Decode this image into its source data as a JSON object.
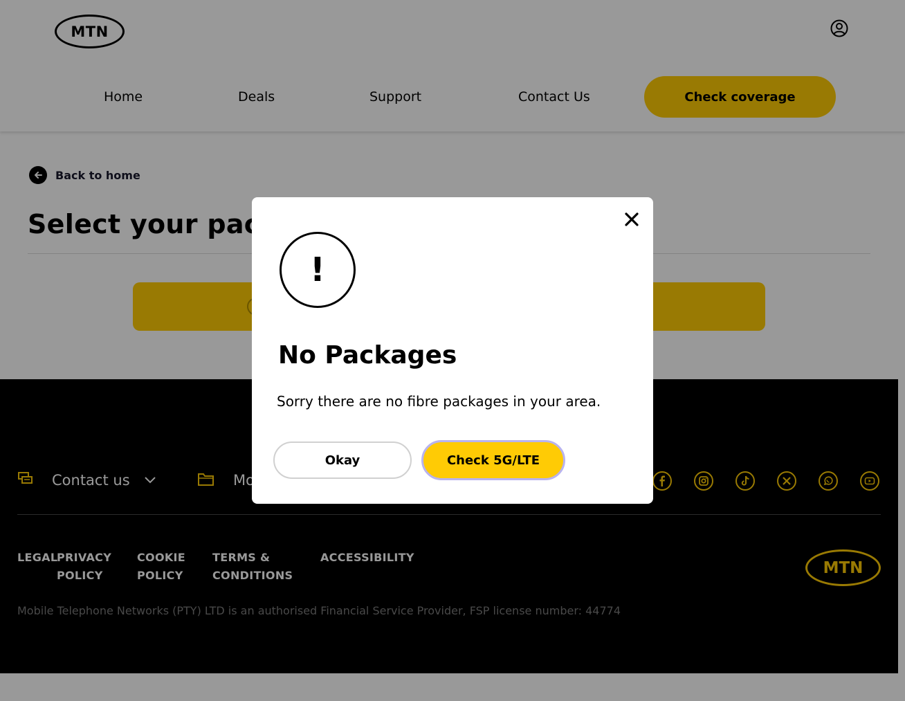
{
  "header": {
    "logo_text": "MTN",
    "nav": [
      {
        "label": "Home"
      },
      {
        "label": "Deals"
      },
      {
        "label": "Support"
      },
      {
        "label": "Contact Us"
      }
    ],
    "cta_label": "Check coverage"
  },
  "main": {
    "back_label": "Back to home",
    "page_title": "Select your pack"
  },
  "footer": {
    "contact_label": "Contact us",
    "more_label": "Mo",
    "socials": [
      "facebook-icon",
      "instagram-icon",
      "tiktok-icon",
      "x-icon",
      "whatsapp-icon",
      "youtube-icon"
    ],
    "legal": [
      {
        "label": "LEGAL"
      },
      {
        "label": "PRIVACY"
      },
      {
        "label": "POLICY"
      },
      {
        "label": "COOKIE"
      },
      {
        "label": "POLICY"
      },
      {
        "label": "TERMS &"
      },
      {
        "label": "CONDITIONS"
      },
      {
        "label": "ACCESSIBILITY"
      }
    ],
    "logo_text": "MTN",
    "fsp_text": "Mobile Telephone Networks (PTY) LTD is an authorised Financial Service Provider, FSP license number: 44774"
  },
  "modal": {
    "icon_text": "!",
    "title": "No Packages",
    "message": "Sorry there are no fibre packages in your area.",
    "okay_label": "Okay",
    "check_label": "Check 5G/LTE"
  },
  "colors": {
    "brand_yellow": "#ffcb05",
    "overlay": "rgba(0,0,0,0.4)",
    "focus_ring": "#b8b3ef"
  }
}
